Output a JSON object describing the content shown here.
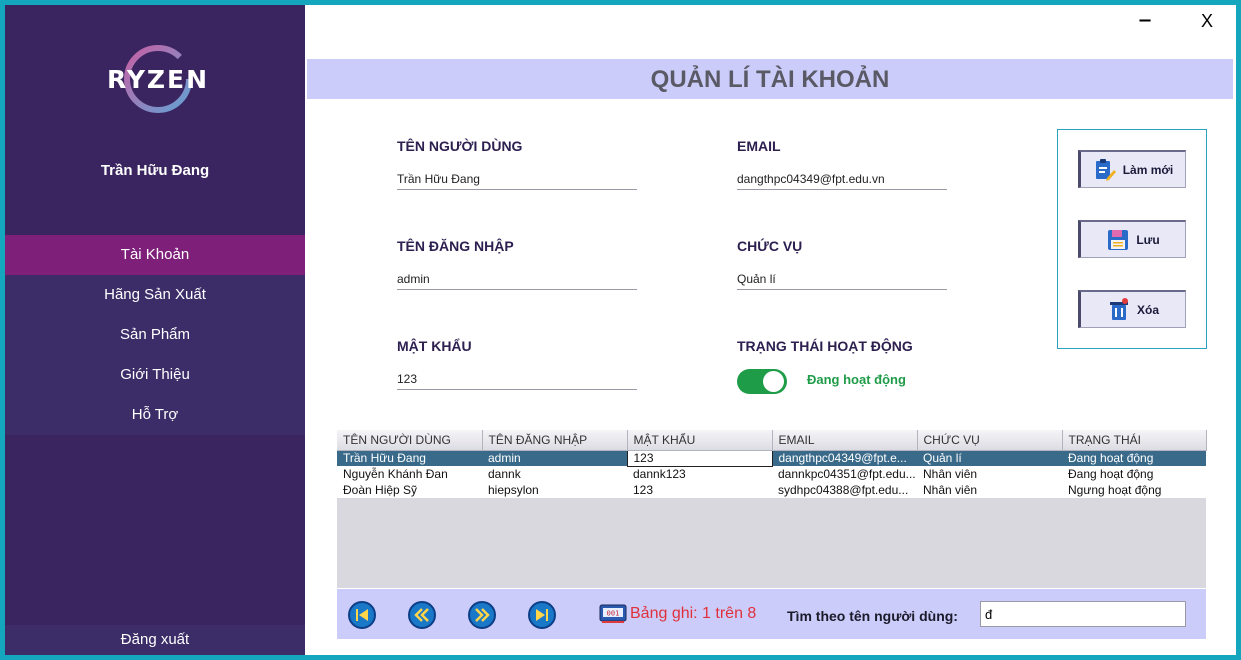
{
  "sidebar": {
    "logo_text": "RYZEN",
    "user_name": "Trần Hữu Đang",
    "menu": [
      {
        "label": "Tài Khoản",
        "active": true
      },
      {
        "label": "Hãng Sản Xuất",
        "active": false
      },
      {
        "label": "Sản Phẩm",
        "active": false
      },
      {
        "label": "Giới Thiệu",
        "active": false
      },
      {
        "label": "Hỗ Trợ",
        "active": false
      }
    ],
    "logout_label": "Đăng xuất"
  },
  "window": {
    "minimize": "‒",
    "close": "X"
  },
  "page_title": "QUẢN LÍ TÀI KHOẢN",
  "form": {
    "full_name": {
      "label": "TÊN NGƯỜI DÙNG",
      "value": "Trần Hữu Đang"
    },
    "username": {
      "label": "TÊN ĐĂNG NHẬP",
      "value": "admin"
    },
    "password": {
      "label": "MẬT KHẨU",
      "value": "123"
    },
    "email": {
      "label": "EMAIL",
      "value": "dangthpc04349@fpt.edu.vn"
    },
    "role": {
      "label": "CHỨC VỤ",
      "value": "Quản lí"
    },
    "status": {
      "label": "TRẠNG THÁI HOẠT ĐỘNG",
      "value": "Đang hoạt động",
      "on": true
    }
  },
  "actions": {
    "new_label": "Làm mới",
    "save_label": "Lưu",
    "delete_label": "Xóa"
  },
  "table": {
    "headers": [
      "TÊN NGƯỜI DÙNG",
      "TÊN ĐĂNG NHẬP",
      "MẬT KHẨU",
      "EMAIL",
      "CHỨC VỤ",
      "TRẠNG THÁI"
    ],
    "rows": [
      [
        "Trần Hữu Đang",
        "admin",
        "123",
        "dangthpc04349@fpt.e...",
        "Quản lí",
        "Đang hoạt động"
      ],
      [
        "Nguyễn Khánh Đan",
        "dannk",
        "dannk123",
        "dannkpc04351@fpt.edu...",
        "Nhân viên",
        "Đang hoạt động"
      ],
      [
        "Đoàn Hiệp Sỹ",
        "hiepsylon",
        "123",
        "sydhpc04388@fpt.edu...",
        "Nhân viên",
        "Ngưng hoạt động"
      ]
    ],
    "selected_row": 0
  },
  "footer": {
    "record_text": "Bảng ghi: 1 trên 8",
    "search_label": "Tìm theo tên người dùng:",
    "search_value": "đ"
  },
  "colors": {
    "accent": "#7e1f79",
    "sidebar": "#3a2560",
    "title_bg": "#ccccfb",
    "status_green": "#1f9c48",
    "record_red": "#e0303a"
  }
}
